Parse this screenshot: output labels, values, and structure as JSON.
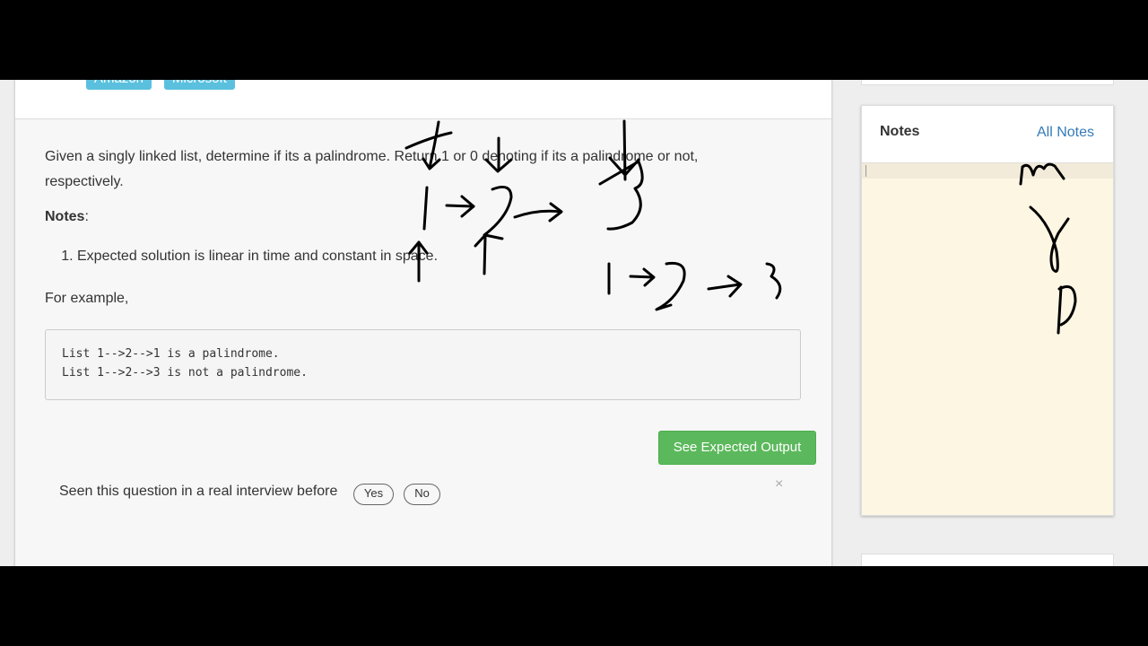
{
  "problem": {
    "tags": [
      "Amazon",
      "Microsoft"
    ],
    "description": "Given a singly linked list, determine if its a palindrome. Return 1 or 0 denoting if its a palindrome or not, respectively.",
    "notes_label": "Notes",
    "notes": [
      "Expected solution is linear in time and constant in space."
    ],
    "example_label": "For example,",
    "code_lines": [
      "List 1-->2-->1 is a palindrome.",
      "List 1-->2-->3 is not a palindrome."
    ],
    "expected_output_button": "See Expected Output",
    "seen_question": "Seen this question in a real interview before",
    "yes_label": "Yes",
    "no_label": "No",
    "dismiss_icon": "×"
  },
  "notes_panel": {
    "title": "Notes",
    "all_notes_link": "All Notes"
  },
  "colors": {
    "tag": "#5bc0de",
    "success_button": "#5cb85c",
    "link": "#337ab7",
    "notes_background": "#fdf6e3"
  },
  "icons": [
    "close-icon",
    "text-caret-icon"
  ]
}
